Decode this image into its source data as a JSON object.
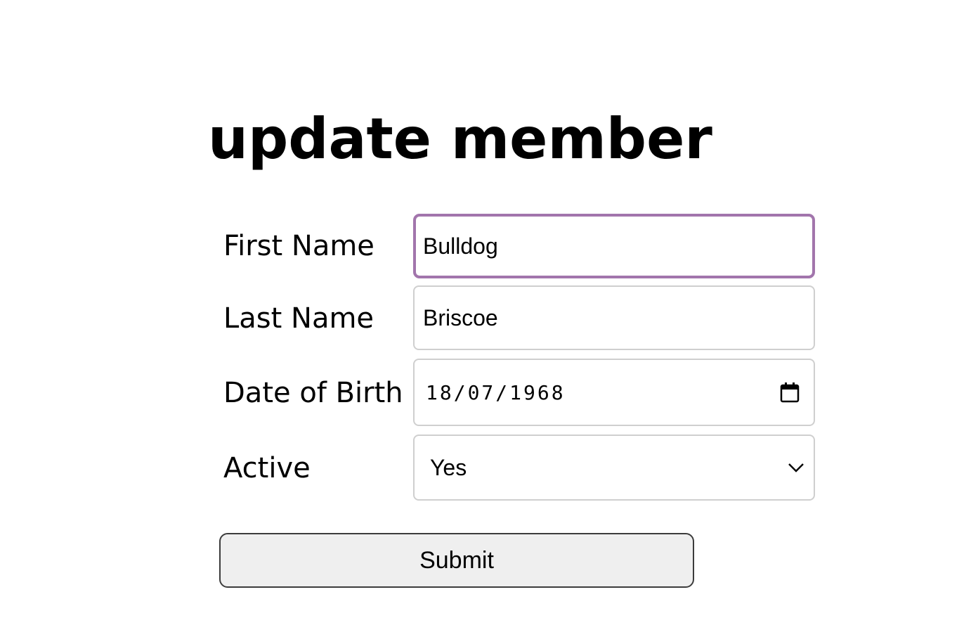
{
  "page": {
    "title": "update member"
  },
  "form": {
    "first_name": {
      "label": "First Name",
      "value": "Bulldog",
      "focused": true
    },
    "last_name": {
      "label": "Last Name",
      "value": "Briscoe"
    },
    "date_of_birth": {
      "label": "Date of Birth",
      "value": "18/07/1968",
      "icon": "calendar-icon"
    },
    "active": {
      "label": "Active",
      "selected": "Yes",
      "icon": "chevron-down-icon"
    },
    "submit_label": "Submit"
  },
  "colors": {
    "focus_border": "#a275ac",
    "input_border": "#cfcfcf",
    "button_background": "#efefef",
    "button_border": "#3c3c3c"
  }
}
